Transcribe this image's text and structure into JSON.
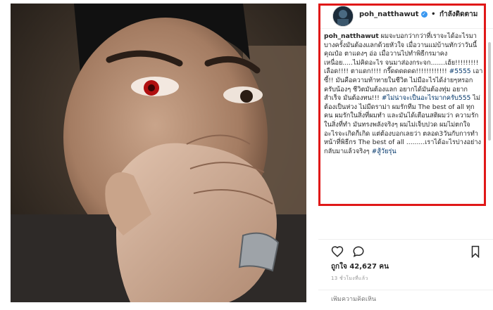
{
  "post": {
    "username": "poh_natthawut",
    "follow_status": "กำลังติดตาม",
    "verified_icon": "verified-badge-icon",
    "caption_user": "poh_natthawut",
    "caption_body": "ผมจะบอกว่ากว่าที่เราจะได้อะไรมา บางครั้งมันต้องแลกด้วยหัวใจ เมื่อวานแม่บ้านทักว่าวันนี้คุณป๋อ ตาแดงๆ อ่อ เมื่อวานไปทำพิธีกรมาคงเหนื่อย.....ไม่คิดอะไร จนมาส่องกระจก.......เฮ้ย!!!!!!!!! เลือด!!!! ตาแดก!!!! กรี๊ดดดดดด!!!!!!!!!!!! ",
    "hashtag_1": "#5555",
    "caption_body_2": " เอาซี้!! มันคือความท้าทายในชีวิต ไม่มีอะไรได้ง่ายๆหรอกครับน้องๆ ชีวิตมันต้องแลก อยากได้มันต้องทุ่ม อยากสำเร็จ มันต้องทน!!! ",
    "hashtag_2": "#ไม่น่าจะเป็นอะไรมากครับ555",
    "caption_body_3": " ไม่ต้องเป็นห่วง ไม่มีดราม่า ผมรักทีม The best of all ทุกคน ผมรักในสิ่งที่ผมทำ และมันได้เตือนสติผมว่า ความรักในสิ่งที่ทำ มันทรงพลังจริงๆ ผมไม่เจ็บปวด ผมไม่ตกใจ อะไรจะเกิดก็เกิด แต่ต้องบอกเลยว่า ตลอด3วันกับการทำหน้าที่พิธีกร The best of all .........เราได้อะไรบ่างอย่างกลับมาแล้วจริงๆ ",
    "hashtag_3": "#สู้วัยรุ่น",
    "likes": "ถูกใจ 42,627 คน",
    "timestamp": "13 ชั่วโมงที่แล้ว",
    "comment_placeholder": "เพิ่มความคิดเห็น"
  },
  "icons": {
    "like": "heart-icon",
    "comment": "comment-bubble-icon",
    "save": "bookmark-icon"
  },
  "colors": {
    "highlight_border": "#e01818",
    "hashtag": "#003569",
    "verified": "#3897f0"
  }
}
